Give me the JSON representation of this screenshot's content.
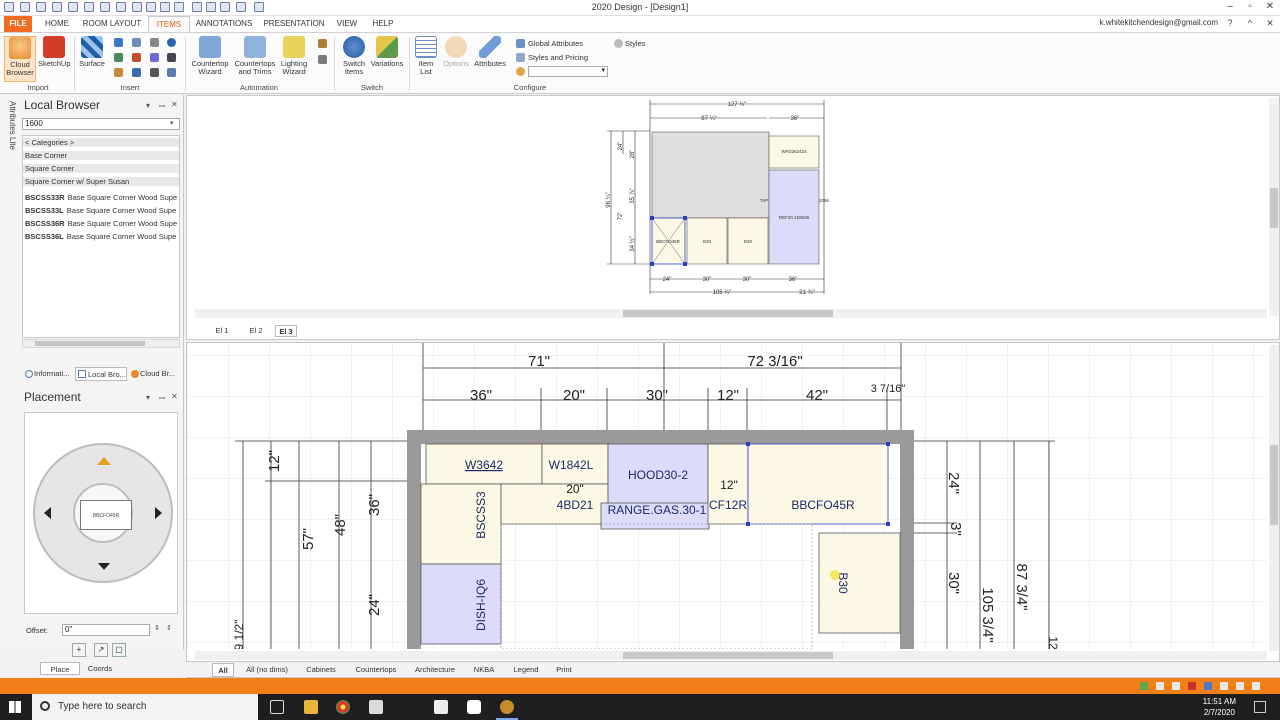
{
  "window": {
    "title": "2020 Design - [Design1]",
    "account": "k.whitekitchendesign@gmail.com"
  },
  "ribbon_tabs": [
    "FILE",
    "HOME",
    "ROOM LAYOUT",
    "ITEMS",
    "ANNOTATIONS",
    "PRESENTATION",
    "VIEW",
    "HELP"
  ],
  "ribbon": {
    "import": {
      "cloud_browser": "Cloud\nBrowser",
      "sketchup": "SketchUp",
      "group": "Import"
    },
    "insert": {
      "surface": "Surface",
      "group": "Insert"
    },
    "automation": {
      "countertop_wizard": "Countertop\nWizard",
      "countertops_trims": "Countertops\nand Trims",
      "lighting_wizard": "Lighting\nWizard",
      "group": "Automation"
    },
    "switch": {
      "switch_items": "Switch\nItems",
      "variations": "Variations",
      "group": "Switch"
    },
    "configure": {
      "item_list": "Item\nList",
      "options": "Options",
      "attributes": "Attributes",
      "global_attributes": "Global Attributes",
      "styles_pricing": "Styles and Pricing",
      "styles": "Styles",
      "group": "Configure"
    }
  },
  "local_browser": {
    "vertical_tab": "Attributes Lite",
    "title": "Local Browser",
    "search_value": "1600",
    "categories_link": "< Categories >",
    "breadcrumb": [
      "Base Corner",
      "Square Corner",
      "Square Corner w/ Super Susan"
    ],
    "items": [
      {
        "code": "BSCSS33R",
        "desc": "Base Square Corner Wood Supe"
      },
      {
        "code": "BSCSS33L",
        "desc": "Base Square Corner Wood Supe"
      },
      {
        "code": "BSCSS36R",
        "desc": "Base Square Corner Wood Supe"
      },
      {
        "code": "BSCSS36L",
        "desc": "Base Square Corner Wood Supe"
      }
    ]
  },
  "panel_tabs": [
    "Informati...",
    "Local Bro...",
    "Cloud Br..."
  ],
  "placement": {
    "title": "Placement",
    "preview_label": "BBCFO45R",
    "offset_label": "Offset:",
    "offset_value": "0\"",
    "bottom_tabs": [
      "Place",
      "Coords"
    ]
  },
  "elevation": {
    "tabs": [
      "El 1",
      "El 2",
      "El 3"
    ],
    "dims_top": [
      "127 ¼\"",
      "87 ¼\"",
      "36\""
    ],
    "dims_left": [
      "96 ¼\"",
      "24\"",
      "28\"",
      "35 ⅞\"",
      "72\"",
      "34 ½\""
    ],
    "dims_bottom": [
      "24\"",
      "30\"",
      "30\"",
      "36\"",
      "105 ¼\"",
      "21 ¾\""
    ],
    "labels": [
      "WFD362424",
      "REF20.1DW36",
      "BBCFO45R",
      "B30",
      "B30",
      "TAP",
      "2096"
    ]
  },
  "plan": {
    "dims_top_total": [
      "71\"",
      "72 3/16\""
    ],
    "dims_top": [
      "36\"",
      "20\"",
      "30\"",
      "12\"",
      "42\"",
      "3 7/16\""
    ],
    "dims_left": [
      "12\"",
      "57\"",
      "48\"",
      "36\"",
      "24\"",
      "9 1/2\""
    ],
    "dims_right": [
      "24\"",
      "3\"",
      "30\"",
      "87 3/4\"",
      "105 3/4\"",
      "12"
    ],
    "dims_inner": [
      "20\"",
      "12\""
    ],
    "items": [
      "W3642",
      "W1842L",
      "HOOD30-2",
      "4BD21",
      "RANGE.GAS.30-1",
      "CF12R",
      "BBCFO45R",
      "BSCSS3",
      "DISH-IQ6",
      "B30"
    ]
  },
  "view_tabs": [
    "All",
    "All (no dims)",
    "Cabinets",
    "Countertops",
    "Architecture",
    "NKBA",
    "Legend",
    "Print"
  ],
  "taskbar": {
    "search_placeholder": "Type here to search",
    "time": "11:51 AM",
    "date": "2/7/2020"
  },
  "colors": {
    "accent": "#f26b21",
    "status": "#f07f1a",
    "cabinet_fill": "#fcf8e6",
    "selected_fill": "#dcdcfa"
  }
}
